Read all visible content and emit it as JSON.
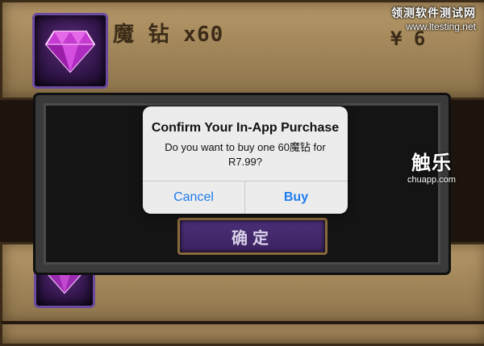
{
  "watermark": {
    "line1": "领测软件测试网",
    "line2": "www.ltesting.net"
  },
  "item": {
    "name": "魔 钻 x60",
    "price": "¥ 6",
    "icon": "purple-diamond-gem-icon"
  },
  "game": {
    "confirm_label": "确定"
  },
  "chuapp": {
    "logo": "触乐",
    "url": "chuapp.com"
  },
  "alert": {
    "title": "Confirm Your In-App Purchase",
    "message": "Do you want to buy one 60魔钻 for R7.99?",
    "cancel_label": "Cancel",
    "buy_label": "Buy"
  },
  "colors": {
    "ios_blue": "#1e7cf0",
    "parchment": "#a2875a",
    "gem_purple": "#5a2a7c"
  }
}
